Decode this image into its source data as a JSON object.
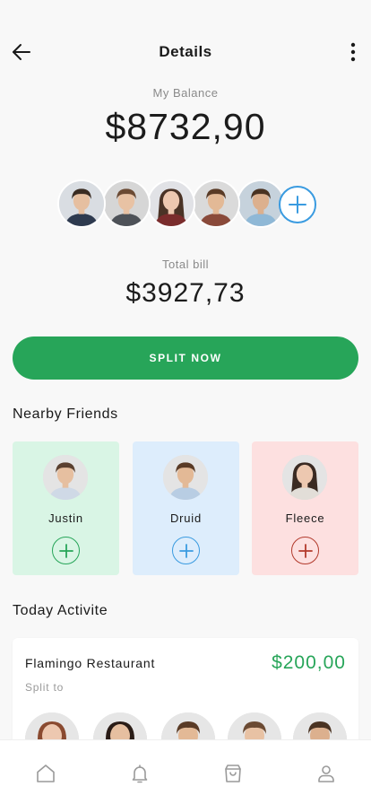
{
  "header": {
    "title": "Details",
    "back_icon": "arrow-left-icon",
    "more_icon": "more-vertical-icon"
  },
  "balance": {
    "label": "My Balance",
    "amount": "$8732,90"
  },
  "members": [
    {
      "name": "member-1",
      "skin": "#e6bfa0",
      "hair": "#3a2c22",
      "shirt": "#2e3a4f",
      "bg": "#d9dde2"
    },
    {
      "name": "member-2",
      "skin": "#e8c2a4",
      "hair": "#6b4a33",
      "shirt": "#4e5258",
      "bg": "#d6d6d6"
    },
    {
      "name": "member-3",
      "skin": "#edc8b0",
      "hair": "#4a3326",
      "shirt": "#7a2c2c",
      "bg": "#e1e2e6"
    },
    {
      "name": "member-4",
      "skin": "#e3b996",
      "hair": "#5a3b26",
      "shirt": "#8a4a3a",
      "bg": "#dadada"
    },
    {
      "name": "member-5",
      "skin": "#dcb08e",
      "hair": "#4a3322",
      "shirt": "#8fb8d6",
      "bg": "#c6d2dc"
    }
  ],
  "bill": {
    "label": "Total bill",
    "amount": "$3927,73"
  },
  "split_button": {
    "label": "SPLIT NOW"
  },
  "nearby": {
    "title": "Nearby Friends",
    "friends": [
      {
        "name": "Justin",
        "card_bg": "#d9f5e5",
        "accent": "#27a559",
        "skin": "#e6bfa0",
        "hair": "#5a4030",
        "shirt": "#cfd9e6"
      },
      {
        "name": "Druid",
        "card_bg": "#ddedfc",
        "accent": "#3a9be0",
        "skin": "#e3b996",
        "hair": "#5a3b26",
        "shirt": "#b8cde3"
      },
      {
        "name": "Fleece",
        "card_bg": "#fde0e0",
        "accent": "#b23a2c",
        "skin": "#edc8b0",
        "hair": "#3a2a22",
        "shirt": "#e2ded8"
      }
    ]
  },
  "activity": {
    "title": "Today Activite",
    "item": {
      "name": "Flamingo Restaurant",
      "amount": "$200,00",
      "subtitle": "Split to"
    }
  },
  "bottom_nav": [
    {
      "name": "home-icon"
    },
    {
      "name": "bell-icon"
    },
    {
      "name": "shopping-bag-icon"
    },
    {
      "name": "profile-icon"
    }
  ],
  "colors": {
    "accent_green": "#27a559",
    "accent_blue": "#3a9be0",
    "accent_red": "#b23a2c",
    "background": "#f8f8f8"
  }
}
